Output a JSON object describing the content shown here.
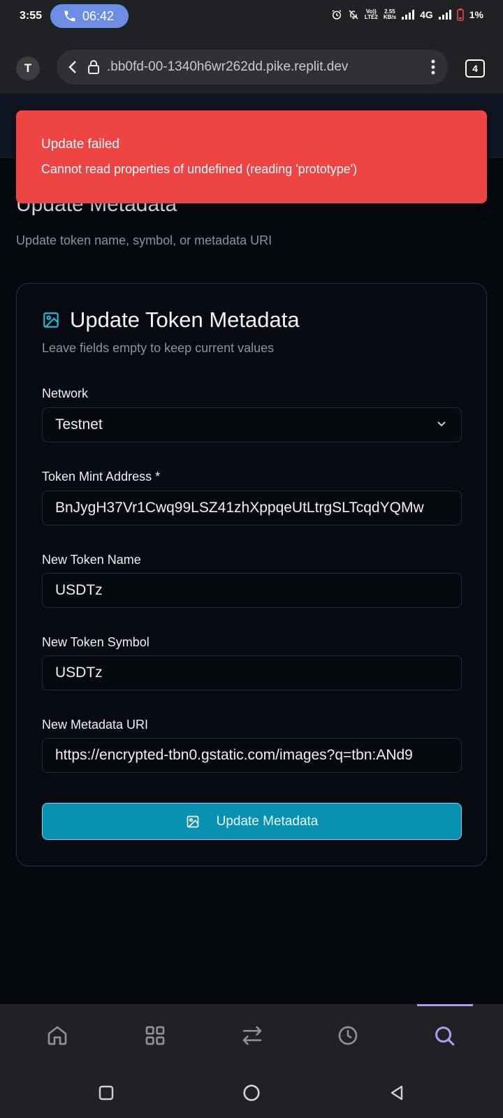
{
  "status_bar": {
    "time": "3:55",
    "call_duration": "06:42",
    "volte_top": "Vo))",
    "volte_bottom": "LTE2",
    "speed_top": "2.55",
    "speed_bottom": "KB/s",
    "network": "4G",
    "battery": "1%"
  },
  "browser": {
    "profile_initial": "T",
    "url": ".bb0fd-00-1340h6wr262dd.pike.replit.dev",
    "tab_count": "4"
  },
  "toast": {
    "title": "Update failed",
    "message": "Cannot read properties of undefined (reading 'prototype')",
    "color": "#ef4444"
  },
  "page": {
    "heading": "Update Metadata",
    "subheading": "Update token name, symbol, or metadata URI"
  },
  "card": {
    "title": "Update Token Metadata",
    "description": "Leave fields empty to keep current values",
    "icon": "image-icon",
    "fields": {
      "network": {
        "label": "Network",
        "value": "Testnet"
      },
      "mint": {
        "label": "Token Mint Address *",
        "value": "BnJygH37Vr1Cwq99LSZ41zhXppqeUtLtrgSLTcqdYQMw"
      },
      "name": {
        "label": "New Token Name",
        "value": "USDTz"
      },
      "symbol": {
        "label": "New Token Symbol",
        "value": "USDTz"
      },
      "uri": {
        "label": "New Metadata URI",
        "value": "https://encrypted-tbn0.gstatic.com/images?q=tbn:ANd9"
      }
    },
    "submit_label": "Update Metadata",
    "accent_color": "#0891b2"
  },
  "bottom_nav": {
    "items": [
      "home-icon",
      "grid-icon",
      "swap-icon",
      "history-icon",
      "search-icon"
    ],
    "active": "search-icon",
    "active_color": "#a99cf2"
  },
  "system_nav": [
    "recents-icon",
    "home-circle-icon",
    "back-triangle-icon"
  ]
}
